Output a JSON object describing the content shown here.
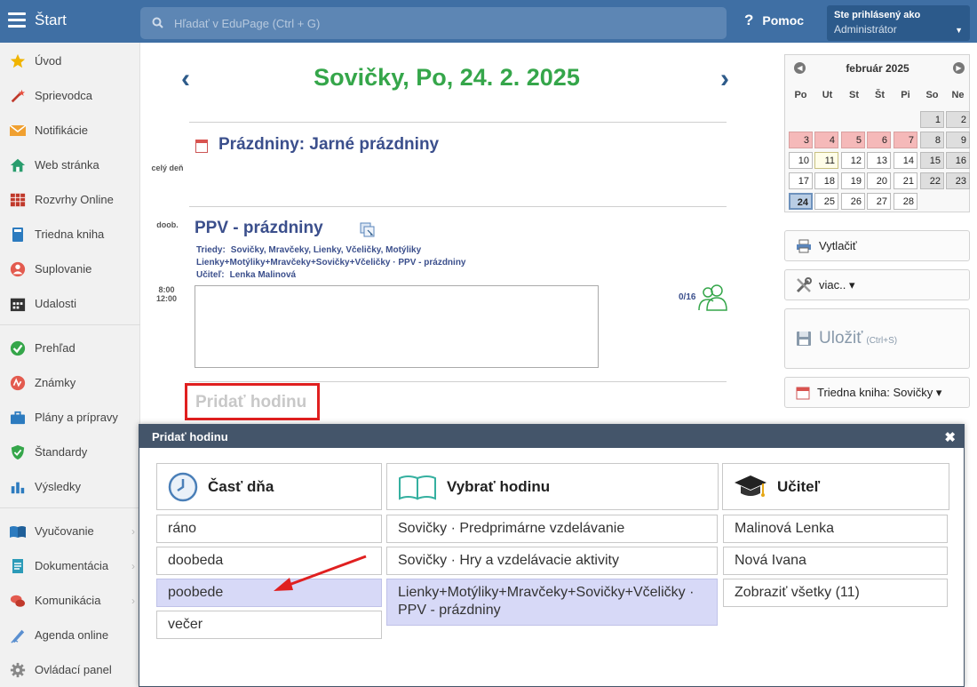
{
  "topbar": {
    "start_label": "Štart",
    "search_placeholder": "Hľadať v EduPage (Ctrl + G)",
    "help_label": "Pomoc",
    "account_line1": "Ste prihlásený ako",
    "account_line2": "Administrátor"
  },
  "sidebar": {
    "items": [
      {
        "label": "Úvod",
        "icon": "star-icon"
      },
      {
        "label": "Sprievodca",
        "icon": "magic-wand-icon"
      },
      {
        "label": "Notifikácie",
        "icon": "envelope-icon"
      },
      {
        "label": "Web stránka",
        "icon": "home-icon"
      },
      {
        "label": "Rozvrhy Online",
        "icon": "timetable-icon"
      },
      {
        "label": "Triedna kniha",
        "icon": "book-icon"
      },
      {
        "label": "Suplovanie",
        "icon": "substitute-icon"
      },
      {
        "label": "Udalosti",
        "icon": "calendar-icon"
      },
      {
        "label": "Prehľad",
        "icon": "check-circle-icon"
      },
      {
        "label": "Známky",
        "icon": "grade-icon"
      },
      {
        "label": "Plány a prípravy",
        "icon": "briefcase-icon"
      },
      {
        "label": "Štandardy",
        "icon": "shield-check-icon"
      },
      {
        "label": "Výsledky",
        "icon": "bar-chart-icon"
      },
      {
        "label": "Vyučovanie",
        "icon": "open-book-icon"
      },
      {
        "label": "Dokumentácia",
        "icon": "document-icon"
      },
      {
        "label": "Komunikácia",
        "icon": "chat-icon"
      },
      {
        "label": "Agenda online",
        "icon": "pen-icon"
      },
      {
        "label": "Ovládací panel",
        "icon": "gear-icon"
      }
    ]
  },
  "main": {
    "day_title": "Sovičky, Po, 24. 2. 2025",
    "prev_arrow": "‹",
    "next_arrow": "›",
    "allday_label": "celý deň",
    "holiday_title": "Prázdniny: Jarné prázdniny",
    "period_label": "doob.",
    "time_from": "8:00",
    "time_to": "12:00",
    "lesson_title": "PPV - prázdniny",
    "classes_key": "Triedy:",
    "classes_value": "Sovičky, Mravčeky, Lienky, Včeličky, Motýliky",
    "groups_value": "Lienky+Motýliky+Mravčeky+Sovičky+Včeličky · PPV - prázdniny",
    "teacher_key": "Učiteľ:",
    "teacher_value": "Lenka Malinová",
    "attendance": "0/16",
    "add_hour_label": "Pridať hodinu"
  },
  "calendar": {
    "month_label": "február 2025",
    "weekdays": [
      "Po",
      "Ut",
      "St",
      "Št",
      "Pi",
      "So",
      "Ne"
    ],
    "days": [
      {
        "d": "1"
      },
      {
        "d": "2"
      },
      {
        "d": "3"
      },
      {
        "d": "4"
      },
      {
        "d": "5"
      },
      {
        "d": "6"
      },
      {
        "d": "7"
      },
      {
        "d": "8"
      },
      {
        "d": "9"
      },
      {
        "d": "10"
      },
      {
        "d": "11"
      },
      {
        "d": "12"
      },
      {
        "d": "13"
      },
      {
        "d": "14"
      },
      {
        "d": "15"
      },
      {
        "d": "16"
      },
      {
        "d": "17"
      },
      {
        "d": "18"
      },
      {
        "d": "19"
      },
      {
        "d": "20"
      },
      {
        "d": "21"
      },
      {
        "d": "22"
      },
      {
        "d": "23"
      },
      {
        "d": "24"
      },
      {
        "d": "25"
      },
      {
        "d": "26"
      },
      {
        "d": "27"
      },
      {
        "d": "28"
      }
    ]
  },
  "right_panel": {
    "print_label": "Vytlačiť",
    "more_label": "viac.. ▾",
    "save_label": "Uložiť",
    "save_shortcut": "(Ctrl+S)",
    "classbook_label": "Triedna kniha: Sovičky ▾"
  },
  "modal": {
    "title": "Pridať hodinu",
    "close": "✖",
    "col1_head": "Časť dňa",
    "col2_head": "Vybrať hodinu",
    "col3_head": "Učiteľ",
    "day_parts": [
      "ráno",
      "doobeda",
      "poobede",
      "večer"
    ],
    "lessons": [
      "Sovičky · Predprimárne vzdelávanie",
      "Sovičky · Hry a vzdelávacie aktivity",
      "Lienky+Motýliky+Mravčeky+Sovičky+Včeličky · PPV - prázdniny"
    ],
    "teachers": [
      "Malinová Lenka",
      "Nová Ivana",
      "Zobraziť všetky (11)"
    ]
  },
  "colors": {
    "topbar": "#3f6fa4",
    "title_green": "#35a64a",
    "highlight": "#d7d9f7",
    "annotation_red": "#e02020"
  }
}
